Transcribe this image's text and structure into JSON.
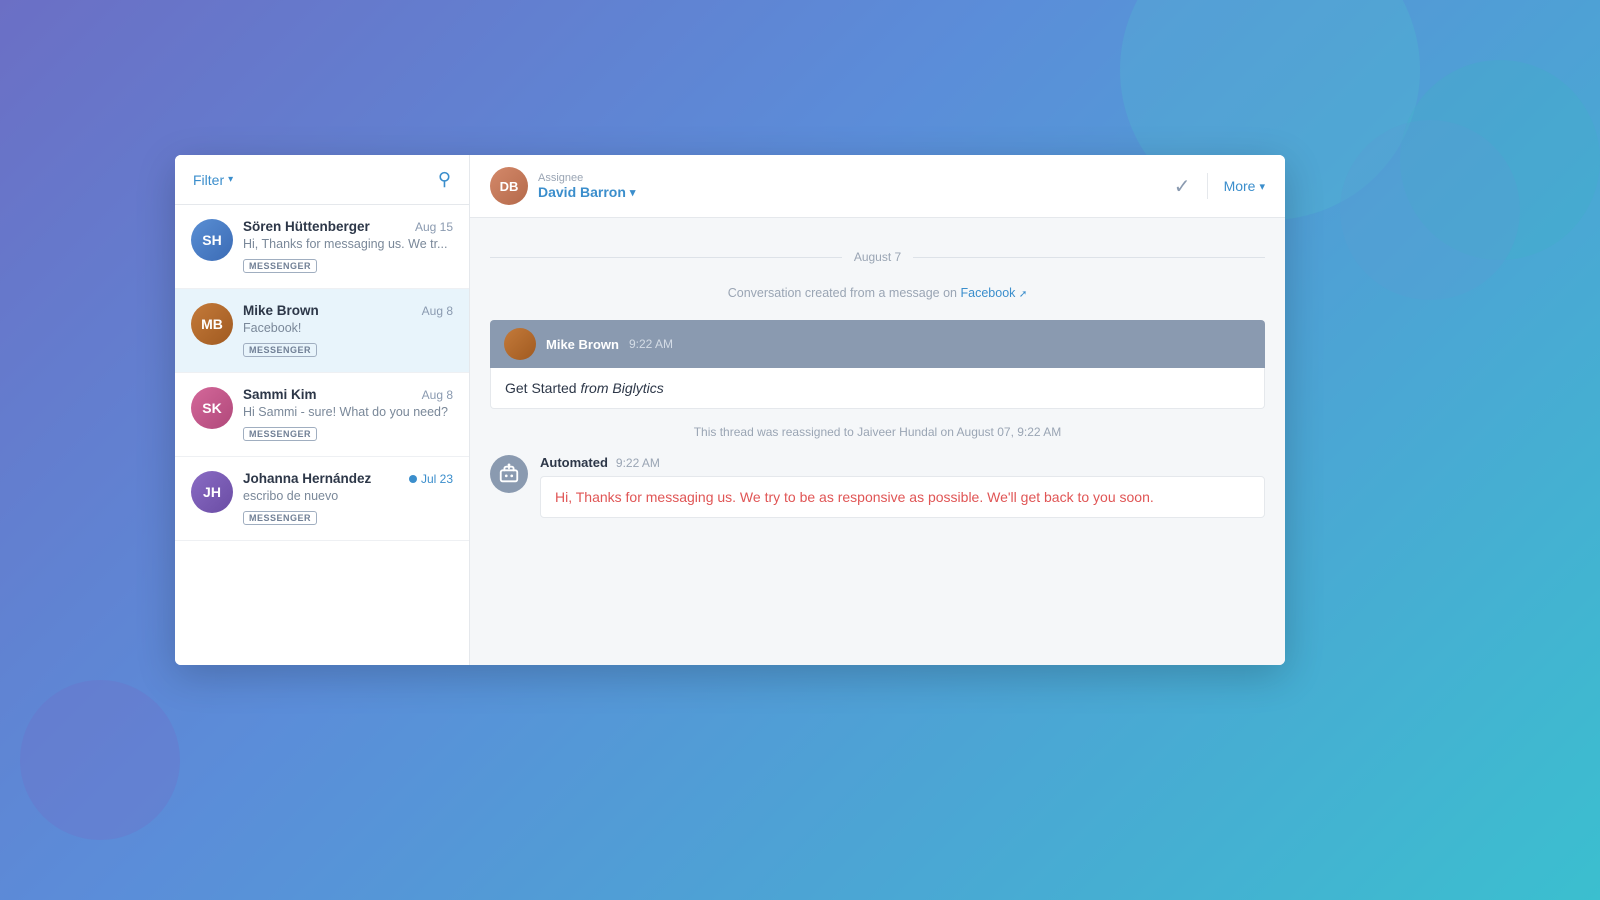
{
  "background": {
    "color_start": "#6b6fc5",
    "color_end": "#3bbfcf"
  },
  "sidebar": {
    "filter_label": "Filter",
    "conversations": [
      {
        "id": "soren",
        "name": "Sören Hüttenberger",
        "date": "Aug 15",
        "preview": "Hi, Thanks for messaging us. We tr...",
        "badge": "MESSENGER",
        "initials": "SH",
        "active": false,
        "has_dot": false,
        "dot_highlight": false
      },
      {
        "id": "mike",
        "name": "Mike Brown",
        "date": "Aug 8",
        "preview": "Facebook!",
        "badge": "MESSENGER",
        "initials": "MB",
        "active": true,
        "has_dot": false,
        "dot_highlight": false
      },
      {
        "id": "sammi",
        "name": "Sammi Kim",
        "date": "Aug 8",
        "preview": "Hi Sammi - sure! What do you need?",
        "badge": "MESSENGER",
        "initials": "SK",
        "active": false,
        "has_dot": false,
        "dot_highlight": false
      },
      {
        "id": "johanna",
        "name": "Johanna Hernández",
        "date": "Jul 23",
        "preview": "escribo de nuevo",
        "badge": "MESSENGER",
        "initials": "JH",
        "active": false,
        "has_dot": true,
        "dot_highlight": true
      }
    ]
  },
  "chat": {
    "assignee_label": "Assignee",
    "assignee_name": "David Barron",
    "more_label": "More",
    "date_divider": "August 7",
    "system_message": "Conversation created from a message on",
    "facebook_link": "Facebook",
    "message1": {
      "sender": "Mike Brown",
      "time": "9:22 AM",
      "body_prefix": "Get Started ",
      "body_italic": "from Biglytics"
    },
    "reassign_msg": "This thread was reassigned to Jaiveer Hundal on August 07, 9:22 AM",
    "automated": {
      "sender": "Automated",
      "time": "9:22 AM",
      "body": "Hi,  Thanks for messaging us. We try to be as responsive as possible. We'll get back to you soon."
    }
  }
}
